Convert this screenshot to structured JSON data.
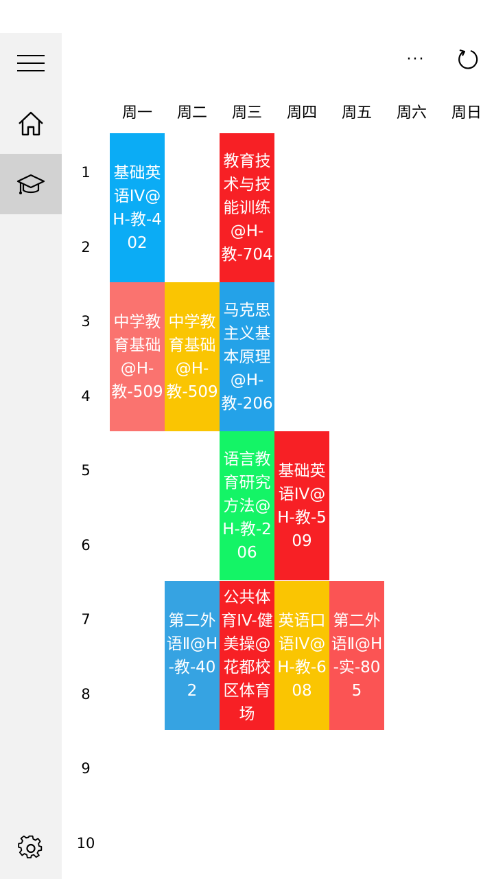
{
  "topbar": {
    "more_label": "···"
  },
  "sidebar": {
    "items": [
      {
        "name": "hamburger-menu-icon",
        "active": false
      },
      {
        "name": "home-icon",
        "active": false
      },
      {
        "name": "graduation-cap-icon",
        "active": true
      },
      {
        "name": "gear-icon",
        "active": false
      }
    ]
  },
  "schedule": {
    "days": [
      "周一",
      "周二",
      "周三",
      "周四",
      "周五",
      "周六",
      "周日"
    ],
    "periods": [
      "1",
      "2",
      "3",
      "4",
      "5",
      "6",
      "7",
      "8",
      "9",
      "10"
    ],
    "courses": [
      {
        "text": "基础英语IV@H-教-402",
        "day": 1,
        "start": 1,
        "span": 2,
        "color": "#0bacf5"
      },
      {
        "text": "教育技术与技能训练@H-教-704",
        "day": 3,
        "start": 1,
        "span": 2,
        "color": "#f72025"
      },
      {
        "text": "中学教育基础@H-教-509",
        "day": 1,
        "start": 3,
        "span": 2,
        "color": "#fa736f"
      },
      {
        "text": "中学教育基础@H-教-509",
        "day": 2,
        "start": 3,
        "span": 2,
        "color": "#fac502"
      },
      {
        "text": "马克思主义基本原理@H-教-206",
        "day": 3,
        "start": 3,
        "span": 2,
        "color": "#24a2e8"
      },
      {
        "text": "语言教育研究方法@H-教-206",
        "day": 3,
        "start": 5,
        "span": 2,
        "color": "#14f466"
      },
      {
        "text": "基础英语IV@H-教-509",
        "day": 4,
        "start": 5,
        "span": 2,
        "color": "#f72025"
      },
      {
        "text": "第二外语Ⅱ@H-教-402",
        "day": 2,
        "start": 7,
        "span": 2,
        "color": "#36a3e2"
      },
      {
        "text": "公共体育IV-健美操@花都校区体育场",
        "day": 3,
        "start": 7,
        "span": 2,
        "color": "#f72025"
      },
      {
        "text": "英语口语IV@H-教-608",
        "day": 4,
        "start": 7,
        "span": 2,
        "color": "#fac502"
      },
      {
        "text": "第二外语Ⅱ@H-实-805",
        "day": 5,
        "start": 7,
        "span": 2,
        "color": "#fb5454"
      }
    ]
  }
}
